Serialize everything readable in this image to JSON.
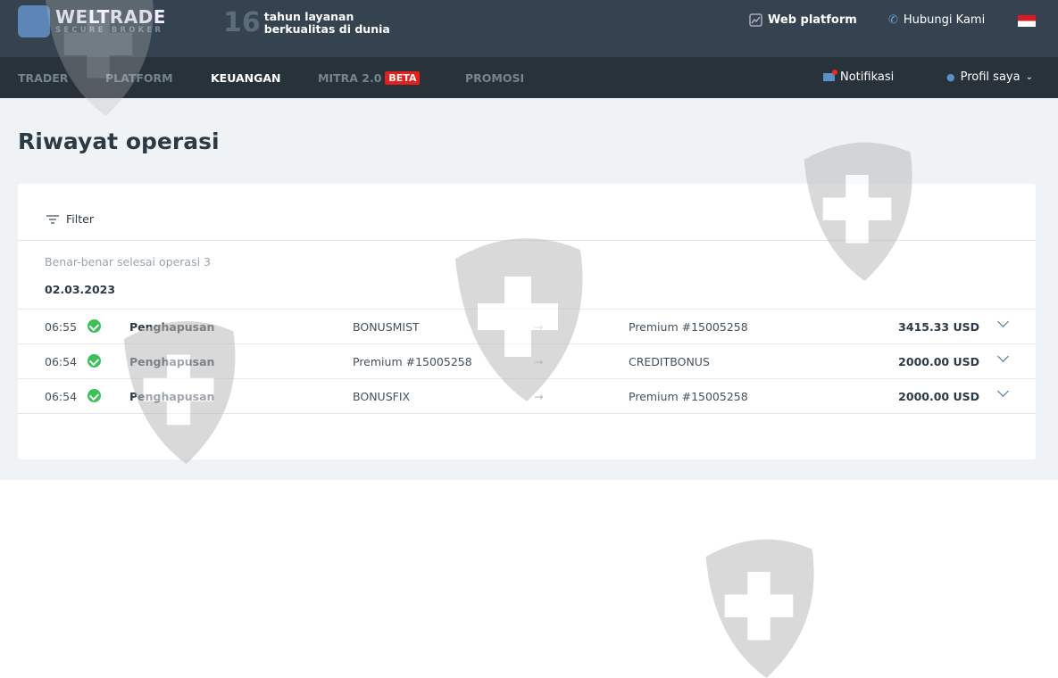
{
  "header": {
    "logo_name": "WELTRADE",
    "logo_sub": "SECURE BROKER",
    "years_num": "16",
    "years_line1": "tahun layanan",
    "years_line2": "berkualitas di dunia",
    "web_platform": "Web platform",
    "contact": "Hubungi Kami"
  },
  "nav": {
    "items": [
      "TRADER",
      "PLATFORM",
      "KEUANGAN",
      "MITRA 2.0",
      "PROMOSI"
    ],
    "beta": "BETA",
    "notifications": "Notifikasi",
    "profile": "Profil saya"
  },
  "page": {
    "title": "Riwayat operasi",
    "filter": "Filter",
    "count_text": "Benar-benar selesai operasi 3",
    "date": "02.03.2023"
  },
  "rows": [
    {
      "time": "06:55",
      "type": "Penghapusan",
      "from": "BONUSMIST",
      "arrow": "→",
      "to": "Premium #15005258",
      "amount": "3415.33 USD"
    },
    {
      "time": "06:54",
      "type": "Penghapusan",
      "from": "Premium #15005258",
      "arrow": "→",
      "to": "CREDITBONUS",
      "amount": "2000.00 USD"
    },
    {
      "time": "06:54",
      "type": "Penghapusan",
      "from": "BONUSFIX",
      "arrow": "→",
      "to": "Premium #15005258",
      "amount": "2000.00 USD"
    }
  ]
}
